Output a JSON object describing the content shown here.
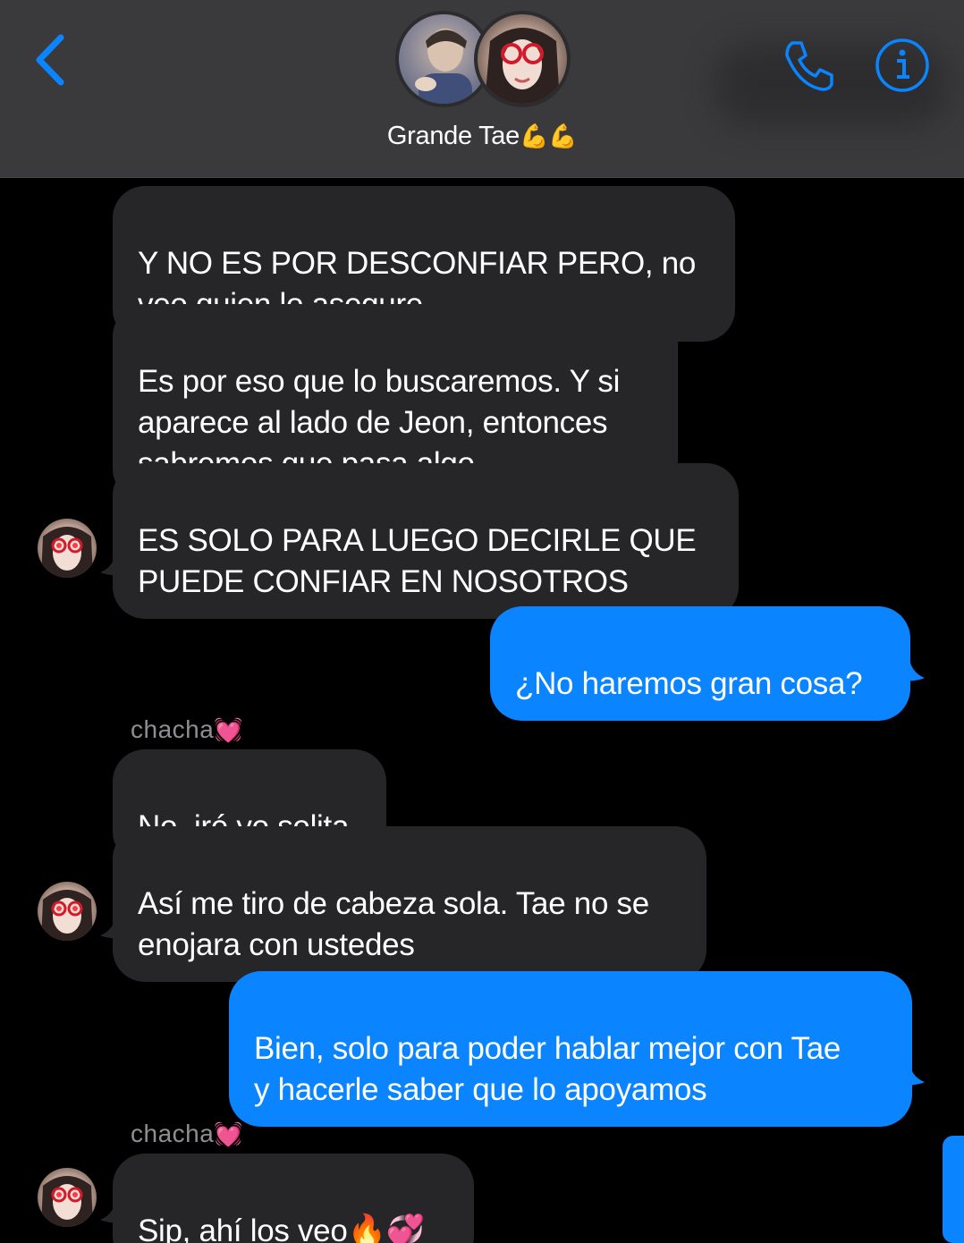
{
  "header": {
    "title": "Grande Tae",
    "title_emoji": "💪💪",
    "back_icon": "chevron-left-icon",
    "phone_icon": "phone-icon",
    "info_icon": "info-icon",
    "accent_color": "#0a84ff"
  },
  "messages": [
    {
      "direction": "in",
      "text": "Y NO ES POR DESCONFIAR PERO, no\nveo quien lo asegure"
    },
    {
      "direction": "in",
      "text": "Es por eso que lo buscaremos. Y si\naparece al lado de Jeon, entonces\nsabremos que pasa algo"
    },
    {
      "direction": "in",
      "text": "ES SOLO PARA LUEGO DECIRLE QUE\nPUEDE CONFIAR EN NOSOTROS"
    },
    {
      "direction": "out",
      "text": "¿No haremos gran cosa?"
    },
    {
      "direction": "in",
      "text": "No, iré yo solita"
    },
    {
      "direction": "in",
      "text": "Así me tiro de cabeza sola. Tae no se\nenojara con ustedes"
    },
    {
      "direction": "out",
      "text": "Bien, solo para poder hablar mejor con Tae\ny hacerle saber que lo apoyamos"
    },
    {
      "direction": "in",
      "text": "Sip, ahí los veo",
      "emoji": "🔥💞"
    }
  ],
  "senders": [
    {
      "name": "chacha",
      "emoji": "💓"
    },
    {
      "name": "chacha",
      "emoji": "💓"
    }
  ],
  "colors": {
    "incoming_bubble": "#262628",
    "outgoing_bubble": "#0a84ff",
    "header_bg": "#3a3a3c",
    "sender_label": "#8e8e93"
  }
}
